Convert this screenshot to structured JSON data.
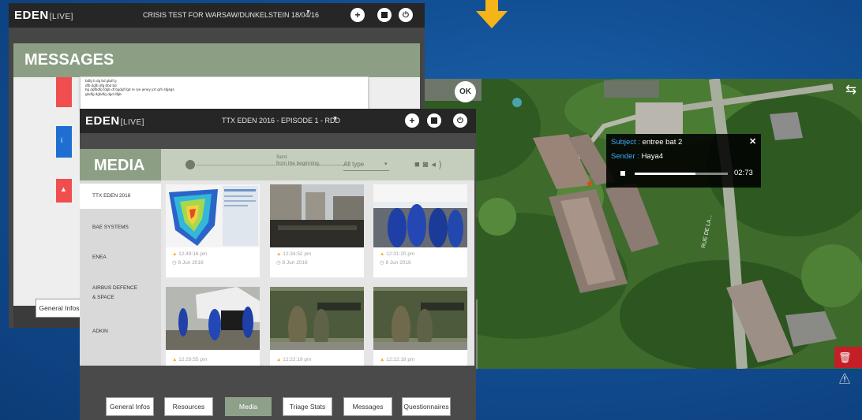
{
  "back_window": {
    "logo": "EDEN",
    "logo_live": "[LIVE]",
    "title": "CRISIS TEST FOR WARSAW/DUNKELSTEIN 18/04/16",
    "section_title": "MESSAGES",
    "message_lines": [
      "bdfg b dg bd gbdf g",
      "dfb dgfb dfg bbd bd",
      "bg dgfbdfg fdgb df bgdgf fgd re rye jeney yzr grh sfgsgs",
      "gbdfg dgbdfg dgd dfgb"
    ],
    "bottom_tab": "General Infos"
  },
  "front_window": {
    "logo": "EDEN",
    "logo_live": "[LIVE]",
    "title": "TTX EDEN 2016 - EPISODE 1 - RDD",
    "section_title": "MEDIA",
    "filter": {
      "sent_line1": "Sent",
      "sent_line2": "from the beginning.",
      "type": "All type"
    },
    "sidebar": [
      "TTX EDEN 2016",
      "BAE SYSTEMS",
      "ENEA",
      "AIRBUS DEFENCE",
      "& SPACE",
      "ADKIN"
    ],
    "media": [
      {
        "time": "12:49:16 pm",
        "date": "8 Jun 2016"
      },
      {
        "time": "12:34:52 pm",
        "date": "8 Jun 2016"
      },
      {
        "time": "12:31:20 pm",
        "date": "8 Jun 2016"
      },
      {
        "time": "12:29:55 pm",
        "date": ""
      },
      {
        "time": "12:22:19 pm",
        "date": ""
      },
      {
        "time": "12:22:18 pm",
        "date": ""
      }
    ],
    "tabs": [
      "General Infos",
      "Resources",
      "Media",
      "Triage Stats",
      "Messages",
      "Questionnaires"
    ],
    "selected_tab": "Media"
  },
  "map": {
    "ok_label": "OK",
    "street_label": "RUE DE LA...",
    "popup": {
      "subject_label": "Subject :",
      "subject": "entree bat 2",
      "sender_label": "Sender :",
      "sender": "Haya4",
      "time": "02:73",
      "progress": 0.65
    }
  },
  "icons": [
    "down-arrow-icon",
    "plus-icon",
    "stop-icon",
    "power-icon",
    "close-icon",
    "video-icon",
    "camera-icon",
    "audio-icon",
    "calendar-icon",
    "warning-icon",
    "trash-icon",
    "expand-icon"
  ],
  "colors": {
    "accent": "#8c9f84",
    "alert": "#c41f26",
    "arrow": "#f5b418",
    "info": "#1f6fd3"
  }
}
